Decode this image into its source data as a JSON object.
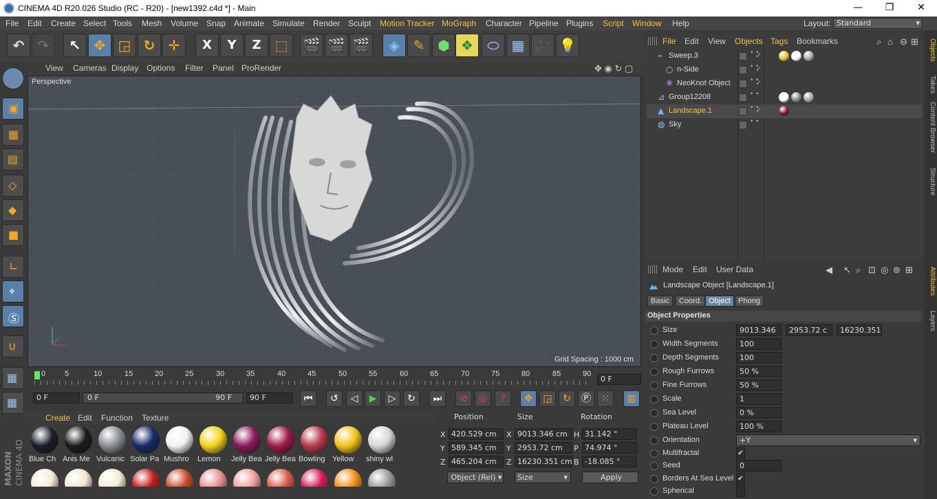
{
  "window": {
    "title": "CINEMA 4D R20.026 Studio (RC - R20) - [new1392.c4d *] - Main",
    "minimize": "—",
    "maximize": "❐",
    "close": "✕"
  },
  "menubar": {
    "items": [
      "File",
      "Edit",
      "Create",
      "Select",
      "Tools",
      "Mesh",
      "Volume",
      "Snap",
      "Animate",
      "Simulate",
      "Render",
      "Sculpt",
      "Motion Tracker",
      "MoGraph",
      "Character",
      "Pipeline",
      "Plugins",
      "Script",
      "Window",
      "Help"
    ],
    "layout_label": "Layout:",
    "layout_value": "Standard"
  },
  "toolbar": {
    "axis_x": "X",
    "axis_y": "Y",
    "axis_z": "Z"
  },
  "viewport": {
    "menu": [
      "View",
      "Cameras",
      "Display",
      "Options",
      "Filter",
      "Panel",
      "ProRender"
    ],
    "label": "Perspective",
    "grid_spacing": "Grid Spacing : 1000 cm"
  },
  "timeline": {
    "ticks": [
      "0",
      "5",
      "10",
      "15",
      "20",
      "25",
      "30",
      "35",
      "40",
      "45",
      "50",
      "55",
      "60",
      "65",
      "70",
      "75",
      "80",
      "85",
      "90"
    ],
    "current_frame": "0 F",
    "start_field": "0 F",
    "range_start": "0 F",
    "range_end": "90 F",
    "end_field": "90 F"
  },
  "materials": {
    "menu": [
      "Create",
      "Edit",
      "Function",
      "Texture"
    ],
    "row1": [
      {
        "name": "Blue Ch",
        "color": "#1a1f2a"
      },
      {
        "name": "Anis Me",
        "color": "#1c1c1c"
      },
      {
        "name": "Vulcanic",
        "color": "#8a8e96"
      },
      {
        "name": "Solar Pa",
        "color": "#1a2a6a"
      },
      {
        "name": "Mushro",
        "color": "#f2f2f2"
      },
      {
        "name": "Lemon",
        "color": "#f0d21a"
      },
      {
        "name": "Jelly Bea",
        "color": "#8a1a5a"
      },
      {
        "name": "Jelly Bea",
        "color": "#a01a4a"
      },
      {
        "name": "Bowling",
        "color": "#b83a4a"
      },
      {
        "name": "Yellow",
        "color": "#f2c21a"
      },
      {
        "name": "shiny wl",
        "color": "#d6d6d6"
      }
    ],
    "row2": [
      {
        "color": "#f4ecd8"
      },
      {
        "color": "#f0e8d0"
      },
      {
        "color": "#f2ecd4"
      },
      {
        "color": "#c81a1a"
      },
      {
        "color": "#c84a2a"
      },
      {
        "color": "#e89090"
      },
      {
        "color": "#f0a0a0"
      },
      {
        "color": "#d85a4a"
      },
      {
        "color": "#d81a5a"
      },
      {
        "color": "#f0901a"
      },
      {
        "color": "#9a9a9a"
      }
    ]
  },
  "coordinates": {
    "headers": {
      "position": "Position",
      "size": "Size",
      "rotation": "Rotation"
    },
    "rows": [
      {
        "axis": "X",
        "pos": "420.529 cm",
        "size_axis": "X",
        "size": "9013.346 cm",
        "rot_axis": "H",
        "rot": "31.142 °"
      },
      {
        "axis": "Y",
        "pos": "589.345 cm",
        "size_axis": "Y",
        "size": "2953.72 cm",
        "rot_axis": "P",
        "rot": "74.974 °"
      },
      {
        "axis": "Z",
        "pos": "465.204 cm",
        "size_axis": "Z",
        "size": "16230.351 cm",
        "rot_axis": "B",
        "rot": "-18.085 °"
      }
    ],
    "mode_select": "Object (Rel)",
    "size_select": "Size",
    "apply_label": "Apply"
  },
  "objects_panel": {
    "menu": [
      "File",
      "Edit",
      "View",
      "Objects",
      "Tags",
      "Bookmarks"
    ],
    "items": [
      {
        "name": "Sweep.3",
        "indent": 0,
        "highlight": false
      },
      {
        "name": "n-Side",
        "indent": 1,
        "highlight": false
      },
      {
        "name": "NeoKnot Object",
        "indent": 1,
        "highlight": false
      },
      {
        "name": "Group12208",
        "indent": 0,
        "highlight": false
      },
      {
        "name": "Landscape.1",
        "indent": 0,
        "highlight": true
      },
      {
        "name": "Sky",
        "indent": 0,
        "highlight": false
      }
    ]
  },
  "attributes": {
    "menu": [
      "Mode",
      "Edit",
      "User Data"
    ],
    "object_title": "Landscape Object [Landscape.1]",
    "tabs": [
      {
        "label": "Basic",
        "active": false
      },
      {
        "label": "Coord.",
        "active": false
      },
      {
        "label": "Object",
        "active": true
      },
      {
        "label": "Phong",
        "active": false
      }
    ],
    "section": "Object Properties",
    "size_label": "Size",
    "size_values": [
      "9013.346",
      "2953.72 c",
      "16230.351"
    ],
    "rows": [
      {
        "label": "Width Segments",
        "value": "100"
      },
      {
        "label": "Depth Segments",
        "value": "100"
      },
      {
        "label": "Rough Furrows",
        "value": "50 %"
      },
      {
        "label": "Fine Furrows",
        "value": "50 %"
      },
      {
        "label": "Scale",
        "value": "1"
      },
      {
        "label": "Sea Level",
        "value": "0 %"
      },
      {
        "label": "Plateau Level",
        "value": "100 %"
      }
    ],
    "orientation_label": "Orientation",
    "orientation_value": "+Y",
    "multifractal_label": "Multifractal",
    "seed_label": "Seed",
    "seed_value": "0",
    "borders_label": "Borders At Sea Level",
    "spherical_label": "Spherical",
    "checkmark": "✔"
  },
  "side_tabs": {
    "top": [
      "Objects",
      "Takes",
      "Content Browser",
      "Structure"
    ],
    "bottom": [
      "Attributes",
      "Layers"
    ]
  },
  "colors": {
    "accent": "#f6c242",
    "panel": "#3a3a3a",
    "viewport": "#474d55",
    "selection": "#5a7fa8"
  }
}
